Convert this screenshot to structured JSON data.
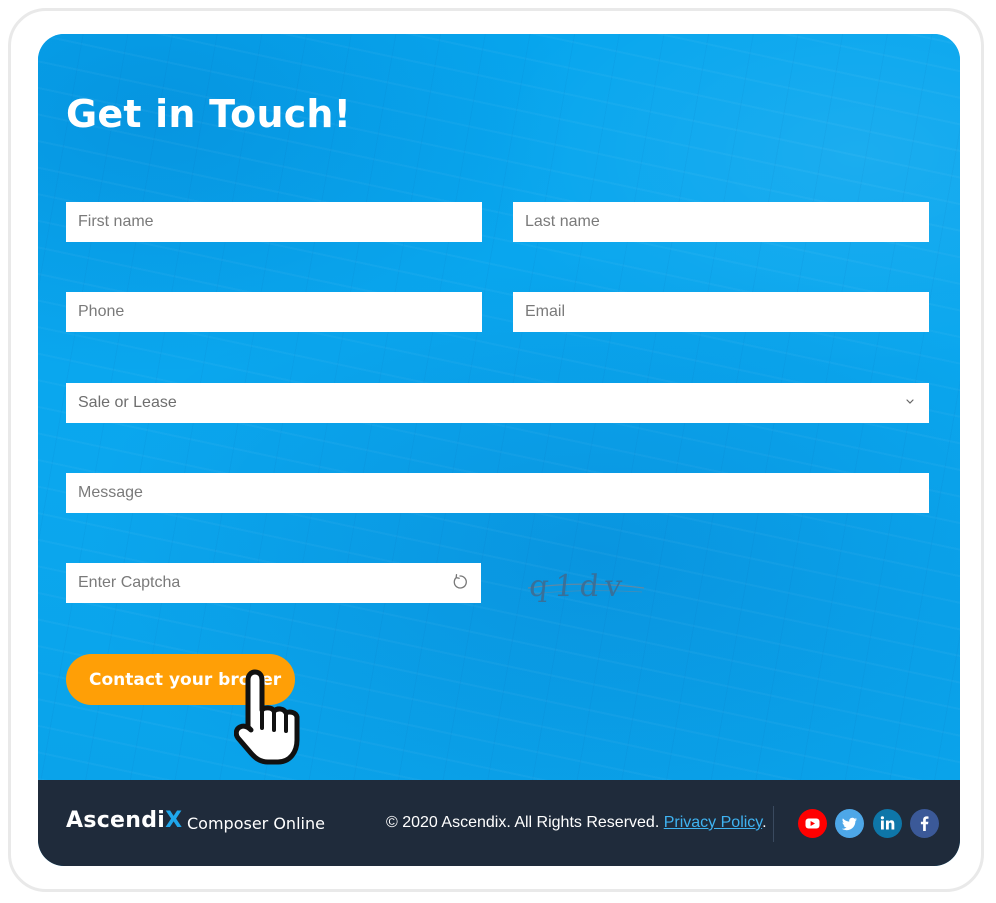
{
  "form": {
    "title": "Get in Touch!",
    "first_name_placeholder": "First name",
    "last_name_placeholder": "Last name",
    "phone_placeholder": "Phone",
    "email_placeholder": "Email",
    "sale_or_lease_value": "Sale or Lease",
    "message_placeholder": "Message",
    "captcha_placeholder": "Enter Captcha",
    "captcha_text": "q1dv",
    "submit_label": "Contact your broker"
  },
  "footer": {
    "logo_text": "Ascendi",
    "logo_accent": "X",
    "product_name": "Composer Online",
    "copyright": "© 2020 Ascendix. All Rights Reserved.",
    "privacy_link": "Privacy Policy",
    "privacy_suffix": ".",
    "social": [
      {
        "name": "youtube",
        "color": "#ff0000"
      },
      {
        "name": "twitter",
        "color": "#4da7e8"
      },
      {
        "name": "linkedin",
        "color": "#0e76a8"
      },
      {
        "name": "facebook",
        "color": "#3b5998"
      }
    ]
  },
  "colors": {
    "accent_blue": "#08a8ef",
    "button_orange": "#ff9f06",
    "footer_bg": "#1f2b3b",
    "link_blue": "#3fb3f2"
  }
}
